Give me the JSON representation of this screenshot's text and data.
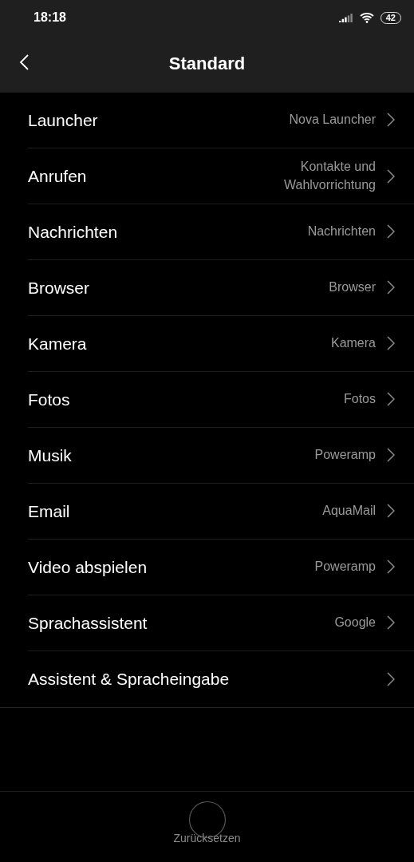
{
  "status_bar": {
    "time": "18:18",
    "battery": "42"
  },
  "header": {
    "title": "Standard"
  },
  "items": [
    {
      "label": "Launcher",
      "value": "Nova Launcher"
    },
    {
      "label": "Anrufen",
      "value": "Kontakte und Wahlvorrichtung"
    },
    {
      "label": "Nachrichten",
      "value": "Nachrichten"
    },
    {
      "label": "Browser",
      "value": "Browser"
    },
    {
      "label": "Kamera",
      "value": "Kamera"
    },
    {
      "label": "Fotos",
      "value": "Fotos"
    },
    {
      "label": "Musik",
      "value": "Poweramp"
    },
    {
      "label": "Email",
      "value": "AquaMail"
    },
    {
      "label": "Video abspielen",
      "value": "Poweramp"
    },
    {
      "label": "Sprachassistent",
      "value": "Google"
    },
    {
      "label": "Assistent & Spracheingabe"
    }
  ],
  "footer": {
    "button": "Zurücksetzen"
  }
}
